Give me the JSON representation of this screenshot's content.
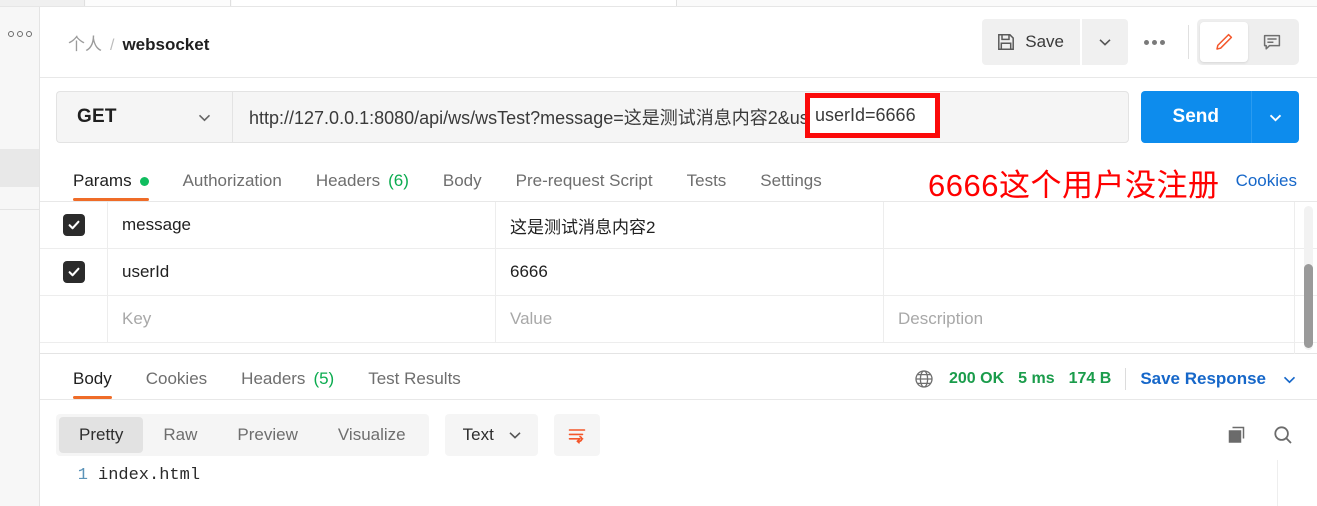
{
  "app": {
    "rail": {
      "menu_icon": "ellipsis-icon"
    }
  },
  "header": {
    "breadcrumb_root": "个人",
    "breadcrumb_separator": "/",
    "breadcrumb_current": "websocket",
    "save_label": "Save",
    "save_icon": "floppy-disk-icon",
    "save_caret_icon": "chevron-down-icon",
    "more_icon": "ellipsis-icon",
    "edit_icon": "pencil-icon",
    "comment_icon": "comment-icon",
    "accent_orange": "#ef6c28"
  },
  "request": {
    "method": "GET",
    "method_caret_icon": "chevron-down-icon",
    "url": "http://127.0.0.1:8080/api/ws/wsTest?message=这是测试消息内容2&userId=6666",
    "url_prefix": "http://127.0.0.1:8080/api/ws/wsTest?message=这是测试消息内容2&",
    "send_label": "Send",
    "send_caret_icon": "chevron-down-icon",
    "send_color": "#0d8ced",
    "tabs": [
      {
        "label": "Params",
        "active": true,
        "dot": true
      },
      {
        "label": "Authorization",
        "active": false
      },
      {
        "label": "Headers",
        "count": "(6)",
        "active": false
      },
      {
        "label": "Body",
        "active": false
      },
      {
        "label": "Pre-request Script",
        "active": false
      },
      {
        "label": "Tests",
        "active": false
      },
      {
        "label": "Settings",
        "active": false
      }
    ],
    "cookies_link": "Cookies"
  },
  "params_table": {
    "headers": {
      "key": "Key",
      "value": "Value",
      "description": "Description"
    },
    "rows": [
      {
        "checked": true,
        "key": "message",
        "value": "这是测试消息内容2",
        "description": ""
      },
      {
        "checked": true,
        "key": "userId",
        "value": "6666",
        "description": ""
      }
    ],
    "placeholder_row": {
      "key": "Key",
      "value": "Value",
      "description": "Description"
    }
  },
  "response": {
    "tabs": [
      {
        "label": "Body",
        "active": true
      },
      {
        "label": "Cookies",
        "active": false
      },
      {
        "label": "Headers",
        "count": "(5)",
        "active": false
      },
      {
        "label": "Test Results",
        "active": false
      }
    ],
    "globe_icon": "globe-icon",
    "status": "200 OK",
    "time": "5 ms",
    "size": "174 B",
    "status_color": "#1a9c4b",
    "save_response_label": "Save Response",
    "save_response_caret_icon": "chevron-down-icon",
    "view_modes": [
      {
        "label": "Pretty",
        "active": true
      },
      {
        "label": "Raw",
        "active": false
      },
      {
        "label": "Preview",
        "active": false
      },
      {
        "label": "Visualize",
        "active": false
      }
    ],
    "format": "Text",
    "format_caret_icon": "chevron-down-icon",
    "wrap_icon": "word-wrap-icon",
    "copy_icon": "copy-icon",
    "search_icon": "search-icon",
    "body_lines": [
      {
        "number": "1",
        "text": "index.html"
      }
    ]
  },
  "annotations": {
    "box_text": "userId=6666",
    "note_text": "6666这个用户没注册",
    "color": "#ff0000"
  }
}
